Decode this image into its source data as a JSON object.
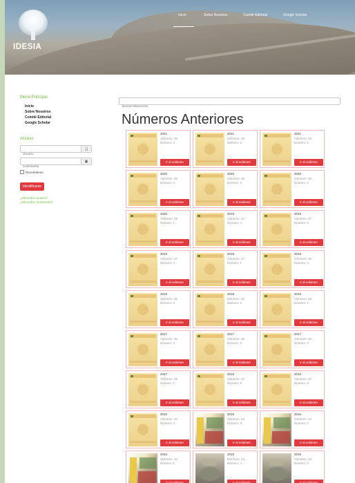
{
  "header": {
    "brand": "IDESIA",
    "nav": [
      {
        "label": "Inicio",
        "active": true
      },
      {
        "label": "Sobre Nosotros",
        "active": false
      },
      {
        "label": "Comité Editorial",
        "active": false
      },
      {
        "label": "Google Scholar",
        "active": false
      }
    ]
  },
  "sidebar": {
    "menu_title": "Menú Principal",
    "menu": [
      "Inicio",
      "Sobre Nosotros",
      "Comité Editorial",
      "Google Scholar"
    ],
    "access_title": "Acceso",
    "username_placeholder": "Usuario",
    "password_placeholder": "Contraseña",
    "remember_label": "Recuérdeme",
    "login_label": "Identificarse",
    "forgot_user": "¿Recordar usuario?",
    "forgot_password": "¿Recordar contraseña?"
  },
  "main": {
    "search_placeholder": "Buscar Manuscrito",
    "title": "Números Anteriores",
    "button_label": "Ir al volúmen",
    "volumes": [
      {
        "year": "2021",
        "volume": "Volúmen: 39",
        "number": "Número: 3",
        "cover": "standard"
      },
      {
        "year": "2021",
        "volume": "Volúmen: 39",
        "number": "Número: 2",
        "cover": "standard"
      },
      {
        "year": "2021",
        "volume": "Volúmen: 39",
        "number": "Número: 1",
        "cover": "standard"
      },
      {
        "year": "2020",
        "volume": "Volúmen: 38",
        "number": "Número: 4",
        "cover": "standard"
      },
      {
        "year": "2020",
        "volume": "Volúmen: 38",
        "number": "Número: 3",
        "cover": "standard"
      },
      {
        "year": "2020",
        "volume": "Volúmen: 38",
        "number": "Número: 2",
        "cover": "standard"
      },
      {
        "year": "2020",
        "volume": "Volúmen: 38",
        "number": "Número: 1",
        "cover": "standard"
      },
      {
        "year": "2019",
        "volume": "Volúmen: 37",
        "number": "Número: 4",
        "cover": "standard"
      },
      {
        "year": "2019",
        "volume": "Volúmen: 37",
        "number": "Número: 3",
        "cover": "standard"
      },
      {
        "year": "2019",
        "volume": "Volúmen: 37",
        "number": "Número: 2",
        "cover": "standard"
      },
      {
        "year": "2019",
        "volume": "Volúmen: 37",
        "number": "Número: 1",
        "cover": "standard"
      },
      {
        "year": "2018",
        "volume": "Volúmen: 36",
        "number": "Número: 4",
        "cover": "standard"
      },
      {
        "year": "2018",
        "volume": "Volúmen: 36",
        "number": "Número: 3",
        "cover": "standard"
      },
      {
        "year": "2018",
        "volume": "Volúmen: 36",
        "number": "Número: 2",
        "cover": "standard"
      },
      {
        "year": "2018",
        "volume": "Volúmen: 36",
        "number": "Número: 1",
        "cover": "standard"
      },
      {
        "year": "2017",
        "volume": "Volúmen: 35",
        "number": "Número: 4",
        "cover": "standard"
      },
      {
        "year": "2017",
        "volume": "Volúmen: 35",
        "number": "Número: 3",
        "cover": "standard"
      },
      {
        "year": "2017",
        "volume": "Volúmen: 35",
        "number": "Número: 2",
        "cover": "standard"
      },
      {
        "year": "2017",
        "volume": "Volúmen: 35",
        "number": "Número: 1",
        "cover": "standard"
      },
      {
        "year": "2016",
        "volume": "Volúmen: 34",
        "number": "Número: 6",
        "cover": "standard"
      },
      {
        "year": "2016",
        "volume": "Volúmen: 34",
        "number": "Número: 5",
        "cover": "standard"
      },
      {
        "year": "2016",
        "volume": "Volúmen: 34",
        "number": "Número: 4",
        "cover": "standard"
      },
      {
        "year": "2016",
        "volume": "Volúmen: 34",
        "number": "Número: 3",
        "cover": "photo"
      },
      {
        "year": "2016",
        "volume": "Volúmen: 34",
        "number": "Número: 2",
        "cover": "photo"
      },
      {
        "year": "2016",
        "volume": "Volúmen: 34",
        "number": "Número: 1",
        "cover": "photo"
      },
      {
        "year": "2015",
        "volume": "Volúmen: 33",
        "number": "Número: 4",
        "cover": "photo2"
      },
      {
        "year": "2015",
        "volume": "Volúmen: 33",
        "number": "Número: 3",
        "cover": "photo2"
      }
    ]
  },
  "colors": {
    "accent": "#e03a3e",
    "green": "#6fbf3a",
    "frame": "#c5d8b9"
  }
}
